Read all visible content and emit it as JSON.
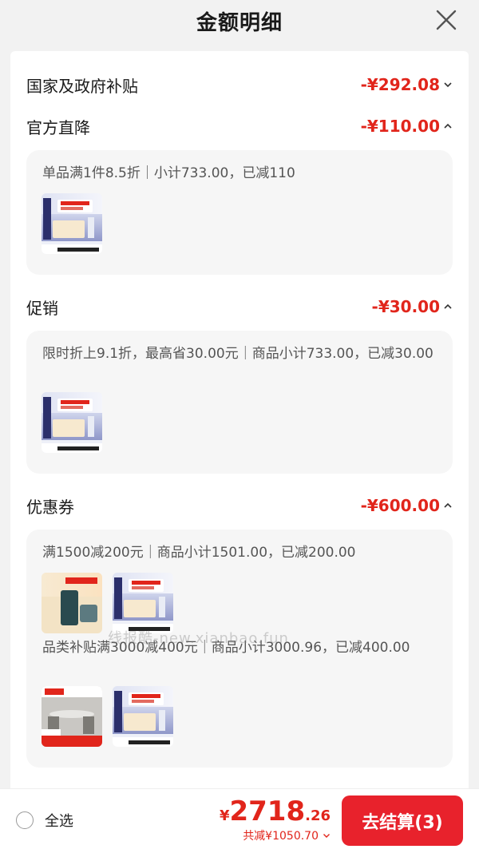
{
  "header": {
    "title": "金额明细"
  },
  "rows": [
    {
      "label": "国家及政府补贴",
      "amount": "-¥292.08",
      "expanded": false
    },
    {
      "label": "官方直降",
      "amount": "-¥110.00",
      "expanded": true
    },
    {
      "label": "促销",
      "amount": "-¥30.00",
      "expanded": true
    },
    {
      "label": "优惠券",
      "amount": "-¥600.00",
      "expanded": true
    }
  ],
  "details": {
    "official": "单品满1件8.5折｜小计733.00，已减110",
    "promo": "限时折上9.1折，最高省30.00元｜商品小计733.00，已减30.00",
    "coupon1": "满1500减200元｜商品小计1501.00，已减200.00",
    "coupon2": "品类补贴满3000减400元｜商品小计3000.96，已减400.00"
  },
  "watermark": "线报酷-new.xianbao.fun",
  "footer": {
    "select_all": "全选",
    "currency": "¥",
    "total_int": "2718",
    "total_dec": ".26",
    "saved": "共减¥1050.70",
    "checkout": "去结算(3)"
  },
  "colors": {
    "accent": "#e1251b",
    "button": "#e8222c",
    "panel": "#ffffff",
    "card": "#f6f6f6"
  },
  "icons": {
    "close": "close-icon",
    "chevron_up": "chevron-up-icon",
    "chevron_down": "chevron-down-icon"
  }
}
